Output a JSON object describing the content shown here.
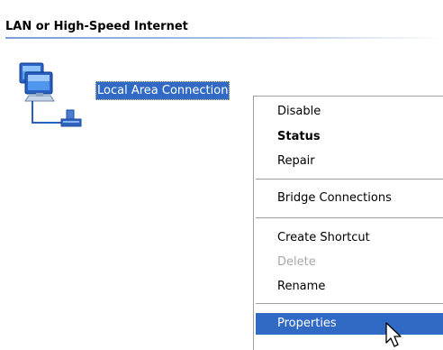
{
  "group": {
    "title": "LAN or High-Speed Internet"
  },
  "connection": {
    "label": "Local Area Connection",
    "icon": "network-connection-icon"
  },
  "context_menu": {
    "items": [
      {
        "label": "Disable",
        "bold": false,
        "disabled": false,
        "selected": false
      },
      {
        "label": "Status",
        "bold": true,
        "disabled": false,
        "selected": false
      },
      {
        "label": "Repair",
        "bold": false,
        "disabled": false,
        "selected": false
      },
      {
        "label": "Bridge Connections",
        "bold": false,
        "disabled": false,
        "selected": false
      },
      {
        "label": "Create Shortcut",
        "bold": false,
        "disabled": false,
        "selected": false
      },
      {
        "label": "Delete",
        "bold": false,
        "disabled": true,
        "selected": false
      },
      {
        "label": "Rename",
        "bold": false,
        "disabled": false,
        "selected": false
      },
      {
        "label": "Properties",
        "bold": false,
        "disabled": false,
        "selected": true
      }
    ]
  },
  "colors": {
    "selection": "#316ac5",
    "disabled_text": "#a8a8a8",
    "header_line": "#76a0d6"
  },
  "icons": {
    "cursor": "arrow-cursor-icon"
  }
}
